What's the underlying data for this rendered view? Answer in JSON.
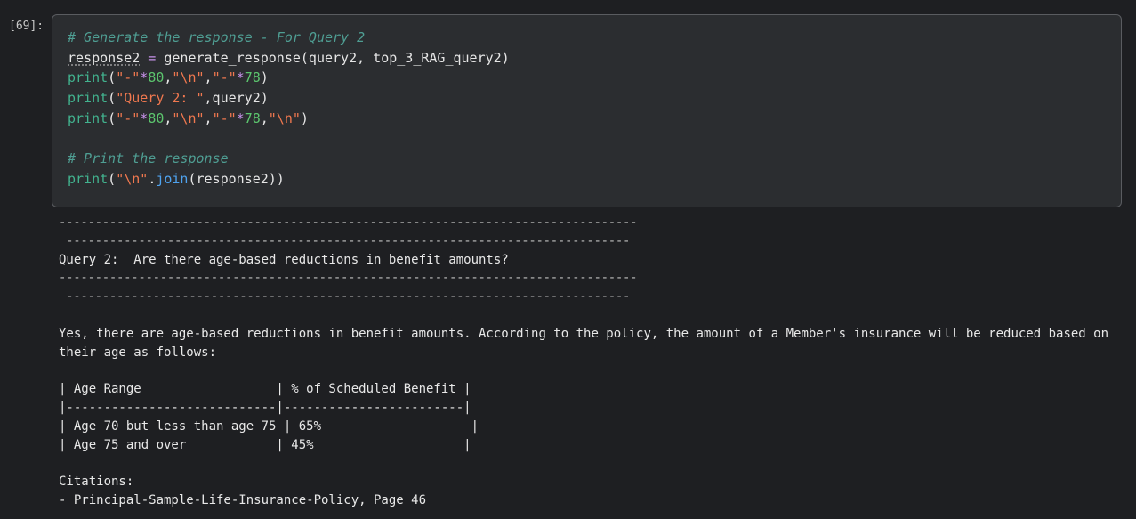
{
  "cell": {
    "prompt": "[69]:",
    "code": {
      "comment1": "# Generate the response - For Query 2",
      "line2": {
        "var": "response2",
        "op": " = ",
        "call": "generate_response(query2, top_3_RAG_query2)"
      },
      "line3": {
        "fn": "print",
        "open": "(",
        "s1": "\"-\"",
        "op1": "*",
        "n1": "80",
        "c1": ",",
        "s2": "\"\\n\"",
        "c2": ",",
        "s3": "\"-\"",
        "op2": "*",
        "n2": "78",
        "close": ")"
      },
      "line4": {
        "fn": "print",
        "open": "(",
        "s1": "\"Query 2: \"",
        "rest": ",query2)"
      },
      "line5": {
        "fn": "print",
        "open": "(",
        "s1": "\"-\"",
        "op1": "*",
        "n1": "80",
        "c1": ",",
        "s2": "\"\\n\"",
        "c2": ",",
        "s3": "\"-\"",
        "op2": "*",
        "n2": "78",
        "c3": ",",
        "s4": "\"\\n\"",
        "close": ")"
      },
      "comment2": "# Print the response",
      "line8": {
        "fn": "print",
        "open": "(",
        "s1": "\"\\n\"",
        "dot": ".",
        "method": "join",
        "rest": "(response2))"
      }
    }
  },
  "output": {
    "dash1": "--------------------------------------------------------------------------------",
    "dash2": " ------------------------------------------------------------------------------",
    "query_line": "Query 2:  Are there age-based reductions in benefit amounts?",
    "dash3": "--------------------------------------------------------------------------------",
    "dash4": " ------------------------------------------------------------------------------",
    "answer": "Yes, there are age-based reductions in benefit amounts. According to the policy, the amount of a Member's insurance will be reduced based on their age as follows:",
    "table": {
      "header": "| Age Range                  | % of Scheduled Benefit |",
      "separator": "|----------------------------|------------------------|",
      "row1": "| Age 70 but less than age 75 | 65%                    |",
      "row2": "| Age 75 and over            | 45%                    |"
    },
    "citations_label": "Citations:",
    "citation1": "- Principal-Sample-Life-Insurance-Policy, Page 46"
  }
}
